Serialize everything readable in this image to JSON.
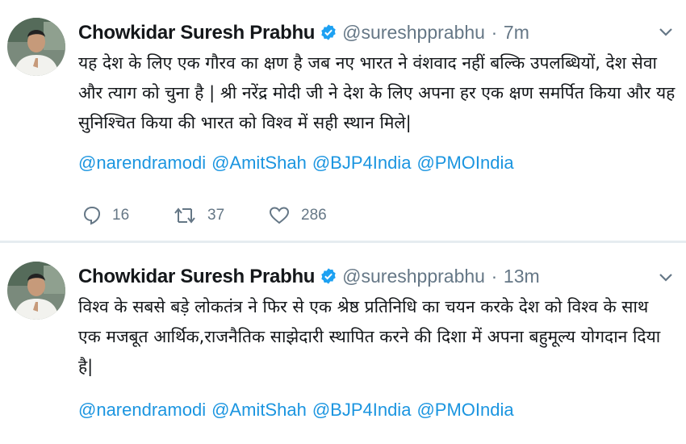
{
  "colors": {
    "link": "#1b95e0",
    "text": "#14171a",
    "muted": "#657786",
    "verified": "#1da1f2",
    "divider": "#e6ecf0"
  },
  "tweets": [
    {
      "name": "Chowkidar Suresh Prabhu",
      "handle": "@sureshpprabhu",
      "dot": "·",
      "time": "7m",
      "body": "यह देश के लिए एक गौरव का क्षण है जब नए भारत ने वंशवाद नहीं बल्कि उपलब्धियों, देश सेवा और त्याग को चुना है | श्री नरेंद्र मोदी जी ने देश के लिए अपना हर एक क्षण समर्पित किया और यह सुनिश्चित किया की भारत को विश्व में सही स्थान मिले|",
      "mentions": [
        "@narendramodi",
        "@AmitShah",
        "@BJP4India",
        "@PMOIndia"
      ],
      "replies": "16",
      "retweets": "37",
      "likes": "286"
    },
    {
      "name": "Chowkidar Suresh Prabhu",
      "handle": "@sureshpprabhu",
      "dot": "·",
      "time": "13m",
      "body": "विश्व के सबसे बड़े लोकतंत्र ने फिर से एक श्रेष्ठ प्रतिनिधि का चयन करके देश को विश्व के साथ एक मजबूत आर्थिक,राजनैतिक साझेदारी स्थापित करने की दिशा में अपना बहुमूल्य योगदान दिया है|",
      "mentions": [
        "@narendramodi",
        "@AmitShah",
        "@BJP4India",
        "@PMOIndia"
      ]
    }
  ],
  "icons": {
    "avatar": "avatar-image",
    "verified": "verified-badge-icon",
    "menu": "chevron-down-icon",
    "reply": "reply-icon",
    "retweet": "retweet-icon",
    "like": "heart-icon"
  }
}
